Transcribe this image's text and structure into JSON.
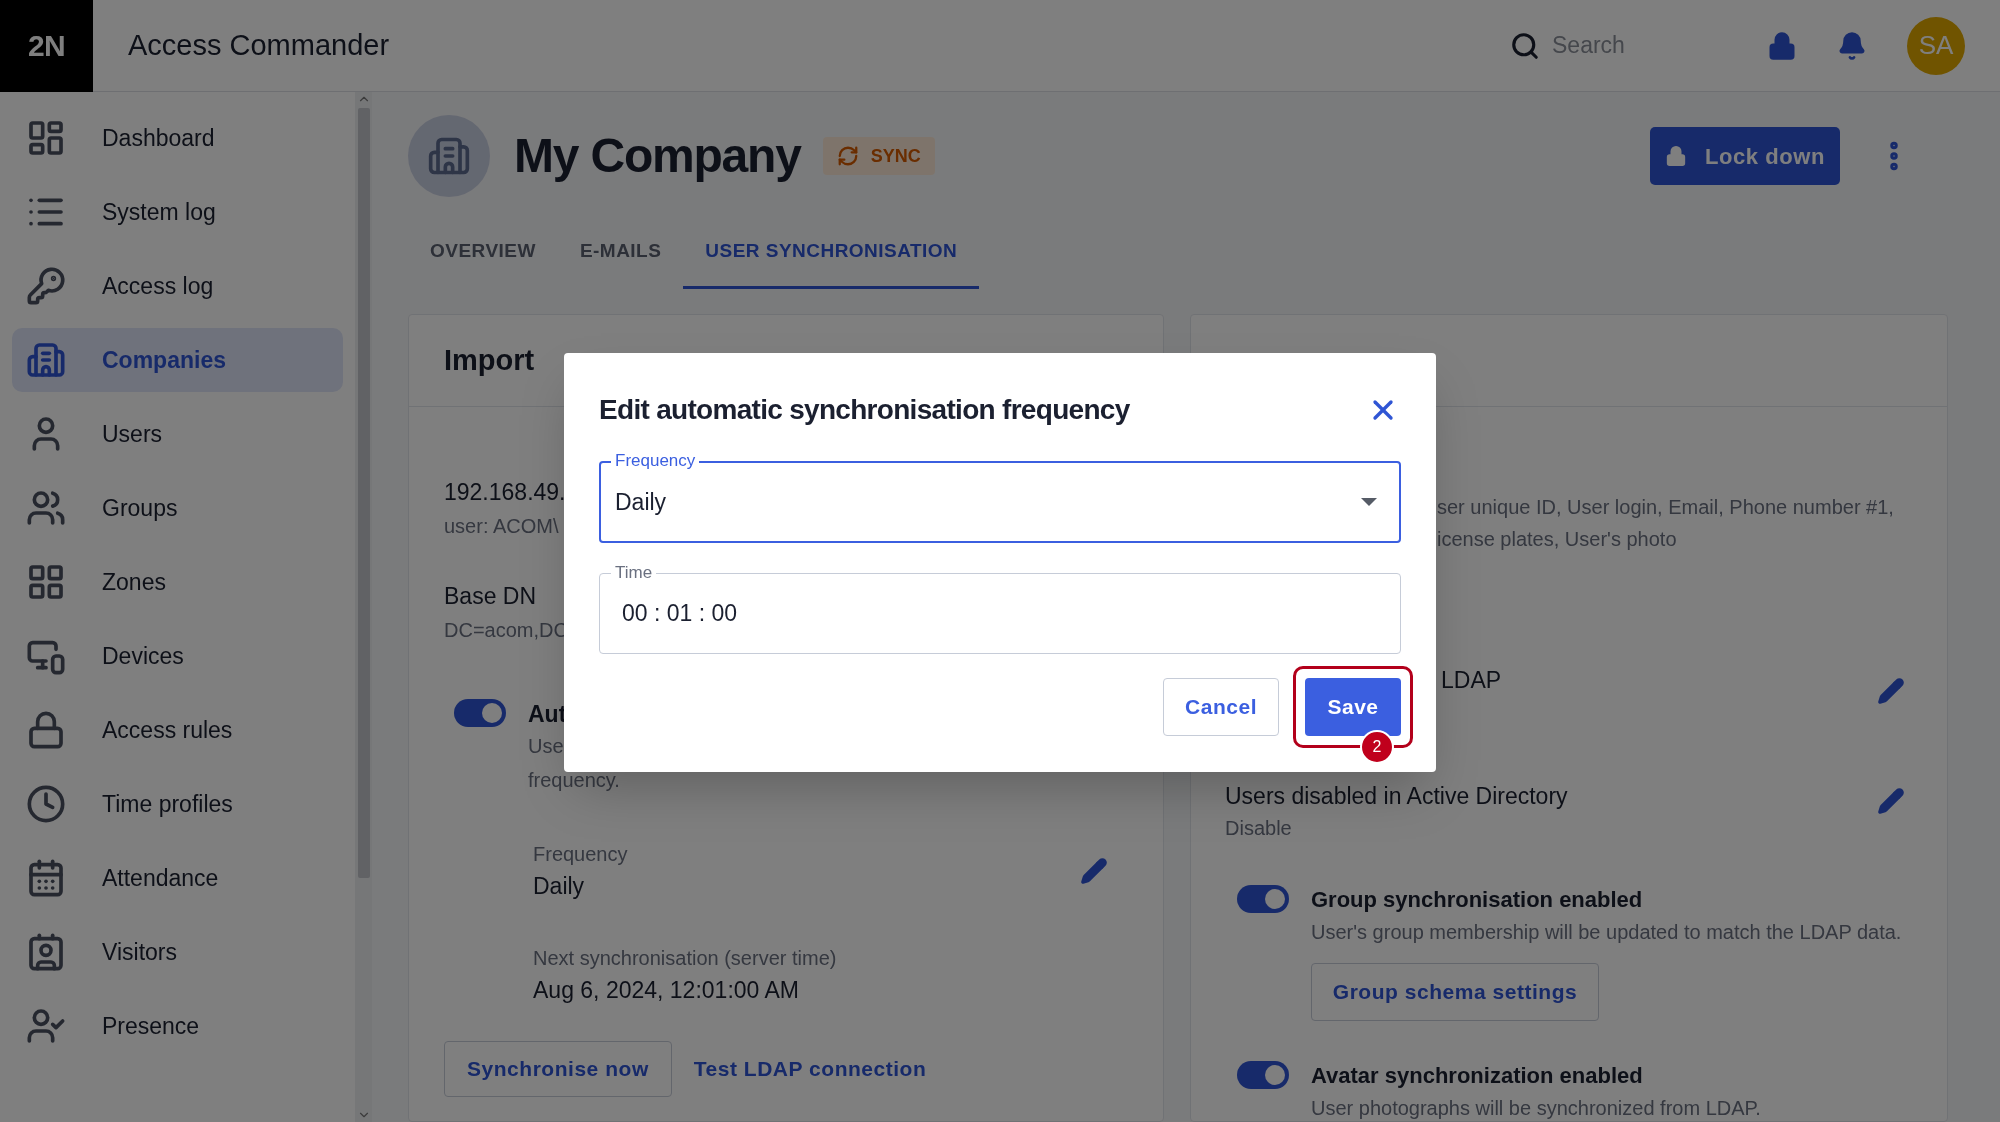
{
  "app": {
    "logo": "2N",
    "title": "Access Commander"
  },
  "search": {
    "placeholder": "Search"
  },
  "user": {
    "initials": "SA"
  },
  "sidebar": {
    "items": [
      {
        "label": "Dashboard",
        "selected": false
      },
      {
        "label": "System log",
        "selected": false
      },
      {
        "label": "Access log",
        "selected": false
      },
      {
        "label": "Companies",
        "selected": true
      },
      {
        "label": "Users",
        "selected": false
      },
      {
        "label": "Groups",
        "selected": false
      },
      {
        "label": "Zones",
        "selected": false
      },
      {
        "label": "Devices",
        "selected": false
      },
      {
        "label": "Access rules",
        "selected": false
      },
      {
        "label": "Time profiles",
        "selected": false
      },
      {
        "label": "Attendance",
        "selected": false
      },
      {
        "label": "Visitors",
        "selected": false
      },
      {
        "label": "Presence",
        "selected": false
      }
    ]
  },
  "page": {
    "title": "My Company",
    "badge": "SYNC",
    "lock_button": "Lock down"
  },
  "tabs": [
    {
      "label": "OVERVIEW",
      "selected": false
    },
    {
      "label": "E-MAILS",
      "selected": false
    },
    {
      "label": "USER SYNCHRONISATION",
      "selected": true
    }
  ],
  "import_card": {
    "title": "Import",
    "server": "192.168.49.",
    "user": "user: ACOM\\",
    "base_dn_label": "Base DN",
    "base_dn": "DC=acom,DC",
    "auto_sync": {
      "on": true,
      "label": "Aut",
      "description": "Use",
      "description_2": "frequency."
    },
    "frequency_label": "Frequency",
    "frequency": "Daily",
    "next_label": "Next synchronisation (server time)",
    "next": "Aug 6, 2024, 12:01:00 AM",
    "buttons": [
      "Synchronise now",
      "Test LDAP connection"
    ]
  },
  "options_card": {
    "attributes": [
      "ser unique ID, User login, Email, Phone number #1,",
      "icense plates, User's photo"
    ],
    "settings": [
      {
        "title": "LDAP"
      },
      {
        "title": "Users disabled in Active Directory",
        "value": "Disable"
      }
    ],
    "toggles": [
      {
        "label": "Group synchronisation enabled",
        "description": "User's group membership will be updated to match the LDAP data.",
        "on": true,
        "button": "Group schema settings"
      },
      {
        "label": "Avatar synchronization enabled",
        "description": "User photographs will be synchronized from LDAP.",
        "on": true
      }
    ]
  },
  "dialog": {
    "title": "Edit automatic synchronisation frequency",
    "frequency": {
      "label": "Frequency",
      "value": "Daily"
    },
    "time": {
      "label": "Time",
      "value": "00 : 01 : 00"
    },
    "buttons": [
      "Cancel",
      "Save"
    ],
    "step_badge": "2"
  }
}
